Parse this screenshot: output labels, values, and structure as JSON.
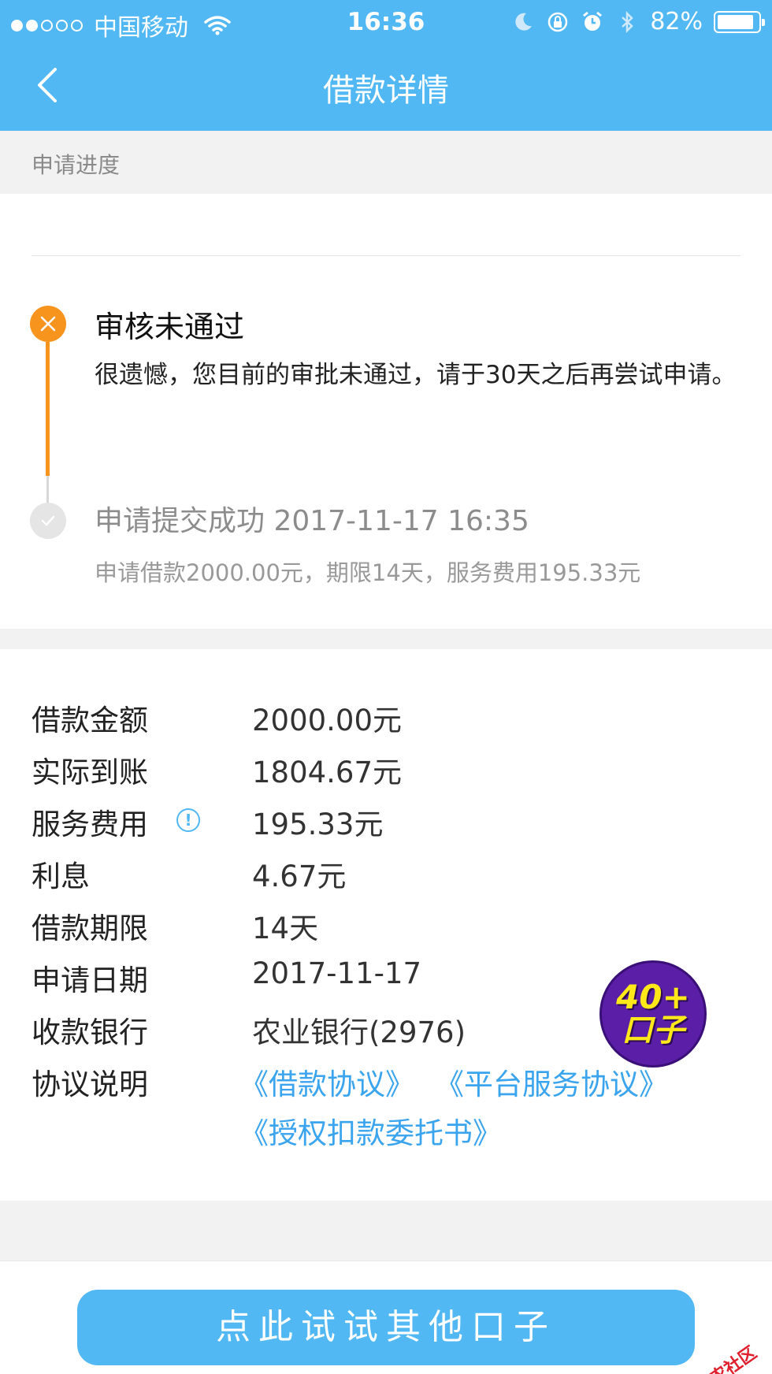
{
  "status_bar": {
    "carrier": "中国移动",
    "time": "16:36",
    "battery": "82%"
  },
  "header": {
    "title": "借款详情"
  },
  "section": {
    "progress_label": "申请进度"
  },
  "steps": [
    {
      "title": "审核未通过",
      "desc": "很遗憾，您目前的审批未通过，请于30天之后再尝试申请。"
    },
    {
      "title": "申请提交成功 2017-11-17 16:35",
      "desc": "申请借款2000.00元，期限14天，服务费用195.33元"
    }
  ],
  "details": [
    {
      "label": "借款金额",
      "value": "2000.00元"
    },
    {
      "label": "实际到账",
      "value": "1804.67元"
    },
    {
      "label": "服务费用",
      "value": "195.33元"
    },
    {
      "label": "利息",
      "value": "4.67元"
    },
    {
      "label": "借款期限",
      "value": "14天"
    },
    {
      "label": "申请日期",
      "value": "2017-11-17"
    },
    {
      "label": "收款银行",
      "value": "农业银行(2976)"
    },
    {
      "label": "协议说明",
      "value": ""
    }
  ],
  "agreements": [
    "《借款协议》",
    "《平台服务协议》",
    "《授权扣款委托书》"
  ],
  "promo": {
    "line1": "40+",
    "line2": "口子"
  },
  "bottom_button": "点此试试其他口子",
  "watermark": "卡农社区",
  "colors": {
    "accent": "#51b8f4",
    "fail": "#f7941d",
    "link": "#3aa4ee"
  }
}
